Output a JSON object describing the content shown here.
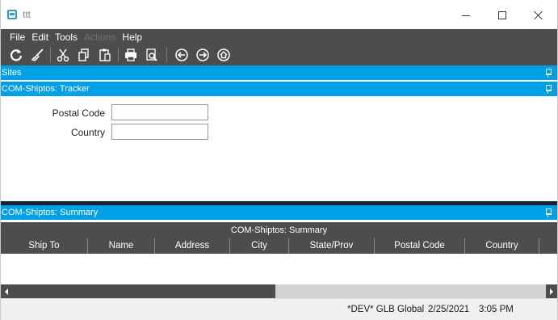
{
  "window": {
    "title": "ttt",
    "accent": "#00a0e6",
    "chrome": "#4d4d4d"
  },
  "menu": {
    "items": [
      {
        "label": "File",
        "enabled": true
      },
      {
        "label": "Edit",
        "enabled": true
      },
      {
        "label": "Tools",
        "enabled": true
      },
      {
        "label": "Actions",
        "enabled": false
      },
      {
        "label": "Help",
        "enabled": true
      }
    ]
  },
  "toolbar": {
    "icons": [
      "refresh-icon",
      "clear-brush-icon",
      "cut-icon",
      "copy-icon",
      "paste-icon",
      "print-icon",
      "print-preview-icon",
      "back-icon",
      "forward-icon",
      "home-icon"
    ]
  },
  "panels": {
    "sites": "Sites",
    "tracker": "COM-Shiptos: Tracker",
    "summary": "COM-Shiptos: Summary"
  },
  "tracker": {
    "postal_code_label": "Postal Code",
    "postal_code_value": "",
    "country_label": "Country",
    "country_value": ""
  },
  "grid": {
    "title": "COM-Shiptos: Summary",
    "columns": [
      "Ship To",
      "Name",
      "Address",
      "City",
      "State/Prov",
      "Postal Code",
      "Country"
    ],
    "rows": []
  },
  "status": {
    "environment": "*DEV* GLB Global",
    "date": "2/25/2021",
    "time": "3:05 PM"
  }
}
